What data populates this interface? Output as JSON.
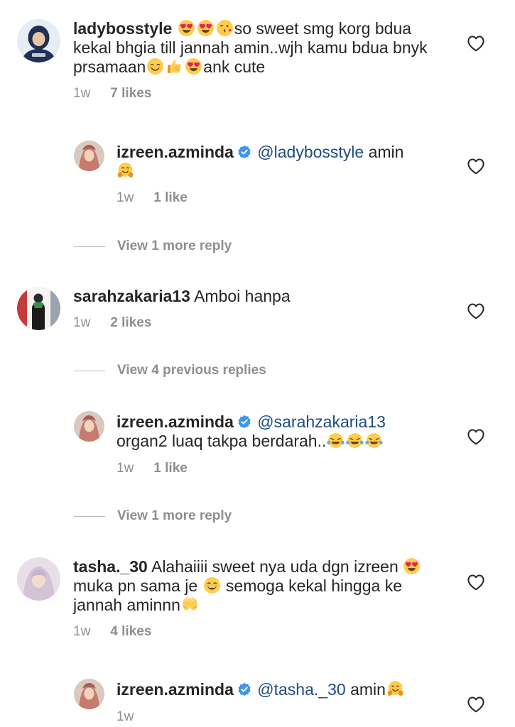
{
  "comments": [
    {
      "username": "ladybosstyle",
      "text_1": "so sweet smg korg",
      "text_2": "bdua kekal bhgia till jannah amin..wjh kamu",
      "text_3": "bdua bnyk prsamaan",
      "text_4": "ank cute",
      "time": "1w",
      "likes": "7 likes",
      "emojis": [
        "heart-eyes",
        "heart-eyes",
        "kiss",
        "smile",
        "thumbs-up",
        "heart-eyes"
      ],
      "reply": {
        "username": "izreen.azminda",
        "mention": "@ladybosstyle",
        "text": "amin",
        "time": "1w",
        "likes": "1 like",
        "emojis": [
          "hug"
        ]
      },
      "view_more": "View 1 more reply"
    },
    {
      "username": "sarahzakaria13",
      "text": "Amboi hanpa",
      "time": "1w",
      "likes": "2 likes",
      "view_more": "View 4 previous replies",
      "reply": {
        "username": "izreen.azminda",
        "mention": "@sarahzakaria13",
        "text": "organ2 luaq takpa berdarah..",
        "time": "1w",
        "likes": "1 like",
        "emojis": [
          "tears-of-joy",
          "tears-of-joy",
          "tears-of-joy"
        ]
      },
      "view_more_2": "View 1 more reply"
    },
    {
      "username": "tasha._30",
      "text_1": "Alahaiiii sweet nya uda dgn izreen",
      "text_2": "muka pn sama je",
      "text_3": "semoga kekal hingga",
      "text_4": "ke jannah aminnn",
      "time": "1w",
      "likes": "4 likes",
      "emojis": [
        "heart-eyes",
        "grin",
        "raised-hands"
      ],
      "reply": {
        "username": "izreen.azminda",
        "mention": "@tasha._30",
        "text": "amin",
        "time": "1w",
        "emojis": [
          "hug"
        ]
      }
    }
  ],
  "icons": {
    "like": "heart-outline-icon",
    "verified": "verified-badge-icon",
    "verified_color": "#3897f0"
  }
}
